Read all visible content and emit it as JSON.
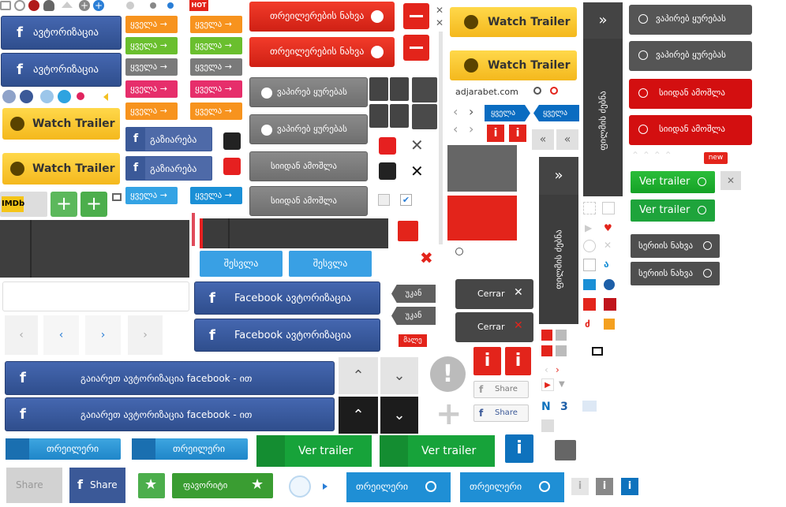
{
  "fb_login": "ავტორიზაცია",
  "watch_trailer": "Watch Trailer",
  "imdb": "IMDb",
  "play_label": "ყველა",
  "play_arrow": "→",
  "hot": "HOT",
  "new": "new",
  "share_label": "გაზიარება",
  "trailers_view": "თრეილერების ნახვა",
  "watch_later": "ვაპირებ ყურებას",
  "remove_from": "სიიდან ამოშლა",
  "login": "შესვლა",
  "facebook_login": "Facebook ავტორიზაცია",
  "back": "უკან",
  "close": "Cerrar",
  "soon": "მალე",
  "fb_connect_long": "გაიარეთ ავტორიზაცია facebook - ით",
  "trailer": "თრეილერი",
  "ver_trailer": "Ver trailer",
  "favorites": "ფავორიტი",
  "share": "Share",
  "site": "adjarabet.com",
  "series_watch": "სერიის ნახვა",
  "film_list": "ფილმის ძებნა",
  "fb_letter": "f",
  "info_letter": "i",
  "colors": {
    "orange": "#f7931e",
    "green": "#6abf2e",
    "gray": "#7a7a7a",
    "pink": "#e62e6b",
    "blue": "#1a8fd6",
    "red": "#e3241b"
  }
}
